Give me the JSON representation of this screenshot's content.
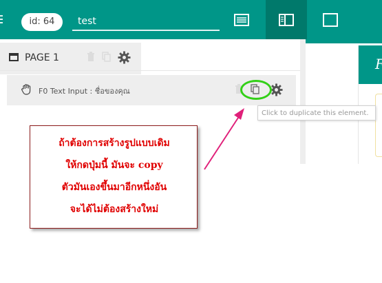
{
  "header": {
    "id_badge": "id: 64",
    "title_value": "test",
    "view_buttons": [
      {
        "name": "list-view",
        "active": false
      },
      {
        "name": "split-view",
        "active": true
      },
      {
        "name": "single-view",
        "active": false
      }
    ]
  },
  "page_tab": {
    "label": "PAGE 1",
    "icons": [
      "window-icon",
      "trash-icon",
      "copy-icon",
      "gear-icon"
    ]
  },
  "element_row": {
    "label": "F0 Text Input : ชื่อของคุณ",
    "icons": [
      "hand-icon",
      "trash-icon",
      "copy-icon",
      "gear-icon"
    ]
  },
  "tooltip": {
    "text": "Click to duplicate this element."
  },
  "preview": {
    "letter": "F"
  },
  "callout": {
    "lines": [
      "ถ้าต้องการสร้างรูปแบบเดิม",
      "ให้กดปุ่มนี้ มันจะ copy",
      "ตัวมันเองขึ้นมาอีกหนึ่งอัน",
      "จะได้ไม่ต้องสร้างใหม่"
    ]
  },
  "colors": {
    "accent": "#009688",
    "accent_dark": "#00796b",
    "highlight": "#33d018",
    "arrow": "#e0207a",
    "callout_text": "#e00000"
  }
}
